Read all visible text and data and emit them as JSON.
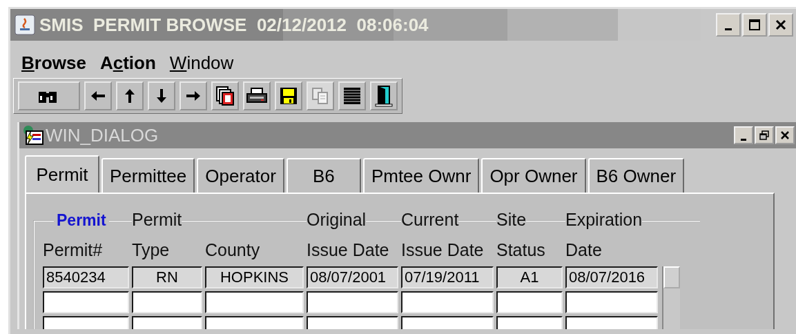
{
  "window": {
    "title": "SMIS  PERMIT BROWSE  02/12/2012  08:06:04"
  },
  "menu": [
    {
      "key": "B",
      "post": "rowse",
      "bold": true
    },
    {
      "pre": "A",
      "key": "c",
      "post": "tion",
      "bold": true
    },
    {
      "key": "W",
      "post": "indow",
      "bold": false
    }
  ],
  "toolbar": [
    {
      "kind": "binoculars",
      "disabled": false,
      "wide": true
    },
    {
      "kind": "left",
      "disabled": false,
      "wide": false
    },
    {
      "kind": "up",
      "disabled": false,
      "wide": false
    },
    {
      "kind": "down",
      "disabled": false,
      "wide": false
    },
    {
      "kind": "right",
      "disabled": false,
      "wide": false
    },
    {
      "kind": "docs",
      "disabled": false,
      "wide": false
    },
    {
      "kind": "print",
      "disabled": false,
      "wide": false
    },
    {
      "kind": "save",
      "disabled": false,
      "wide": false
    },
    {
      "kind": "copy",
      "disabled": true,
      "wide": false
    },
    {
      "kind": "list",
      "disabled": false,
      "wide": false
    },
    {
      "kind": "exit",
      "disabled": false,
      "wide": false
    }
  ],
  "dialog": {
    "title": "WIN_DIALOG"
  },
  "tabs": [
    {
      "label": "Permit",
      "selected": true
    },
    {
      "label": "Permittee",
      "selected": false
    },
    {
      "label": "Operator",
      "selected": false
    },
    {
      "label": "B6",
      "selected": false
    },
    {
      "label": "Pmtee Ownr",
      "selected": false
    },
    {
      "label": "Opr Owner",
      "selected": false
    },
    {
      "label": "B6 Owner",
      "selected": false
    }
  ],
  "group": {
    "title": "Permit"
  },
  "table": {
    "columns": [
      {
        "label": "Permit#"
      },
      {
        "top": "Permit",
        "label": "Type"
      },
      {
        "label": "County"
      },
      {
        "top": "Original",
        "label": "Issue Date"
      },
      {
        "top": "Current",
        "label": "Issue Date"
      },
      {
        "top": "Site",
        "label": "Status"
      },
      {
        "top": "Expiration",
        "label": "Date"
      }
    ],
    "rows": [
      [
        "8540234",
        "RN",
        "HOPKINS",
        "08/07/2001",
        "07/19/2011",
        "A1",
        "08/07/2016"
      ]
    ]
  }
}
